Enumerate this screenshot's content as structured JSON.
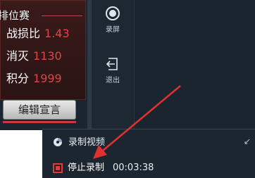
{
  "stats": {
    "title": "排位赛",
    "rows": [
      {
        "label": "战损比",
        "value": "1.43"
      },
      {
        "label": "消灭",
        "value": "1130"
      },
      {
        "label": "积分",
        "value": "1999"
      }
    ]
  },
  "declare_button": {
    "label": "编辑宣言"
  },
  "toolbar": {
    "record": {
      "label": "录屏",
      "icon": "record-icon"
    },
    "exit": {
      "label": "退出",
      "icon": "exit-icon"
    }
  },
  "recording_popup": {
    "title": "录制视频",
    "title_icon": "camera-lens-icon",
    "collapse_icon": "collapse-arrow-icon",
    "stop_label": "停止录制",
    "stop_icon": "stop-icon",
    "elapsed_time": "00:03:38"
  },
  "colors": {
    "accent_red": "#e04545",
    "panel_bg": "#1b2530",
    "stats_bg": "#3a1a1a"
  }
}
